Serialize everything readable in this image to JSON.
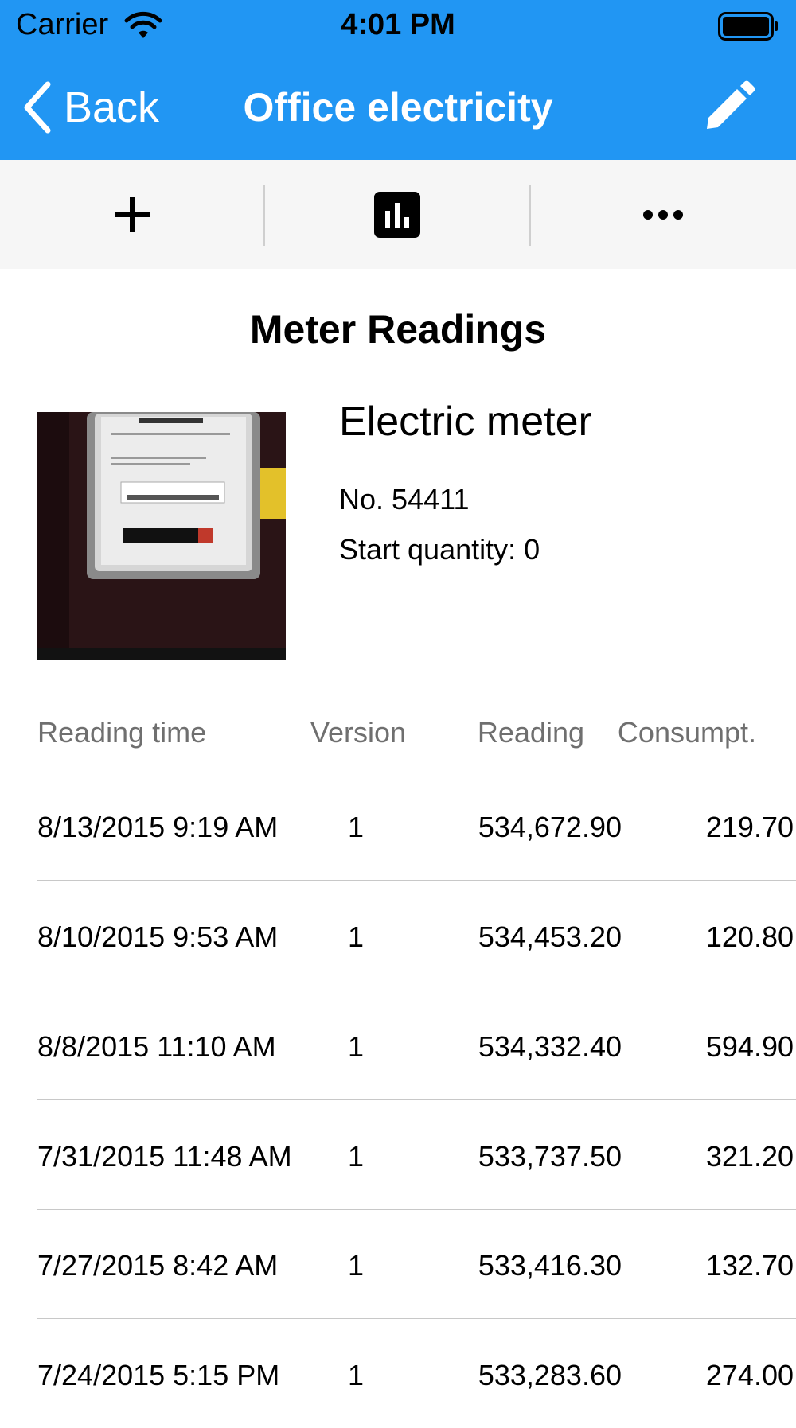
{
  "status_bar": {
    "carrier": "Carrier",
    "time": "4:01 PM"
  },
  "navbar": {
    "back_label": "Back",
    "title": "Office electricity",
    "background": "#2196f3"
  },
  "toolbar": {
    "buttons": [
      "add-icon",
      "chart-icon",
      "more-icon"
    ]
  },
  "section_title": "Meter Readings",
  "meter": {
    "name": "Electric meter",
    "number": "No. 54411",
    "start_quantity": "Start quantity: 0"
  },
  "table": {
    "headers": {
      "time": "Reading time",
      "version": "Version",
      "reading": "Reading",
      "consumption": "Consumpt."
    },
    "rows": [
      {
        "time": "8/13/2015 9:19 AM",
        "version": "1",
        "reading": "534,672.90",
        "consumption": "219.70"
      },
      {
        "time": "8/10/2015 9:53 AM",
        "version": "1",
        "reading": "534,453.20",
        "consumption": "120.80"
      },
      {
        "time": "8/8/2015 11:10 AM",
        "version": "1",
        "reading": "534,332.40",
        "consumption": "594.90"
      },
      {
        "time": "7/31/2015 11:48 AM",
        "version": "1",
        "reading": "533,737.50",
        "consumption": "321.20"
      },
      {
        "time": "7/27/2015 8:42 AM",
        "version": "1",
        "reading": "533,416.30",
        "consumption": "132.70"
      },
      {
        "time": "7/24/2015 5:15 PM",
        "version": "1",
        "reading": "533,283.60",
        "consumption": "274.00"
      }
    ]
  }
}
